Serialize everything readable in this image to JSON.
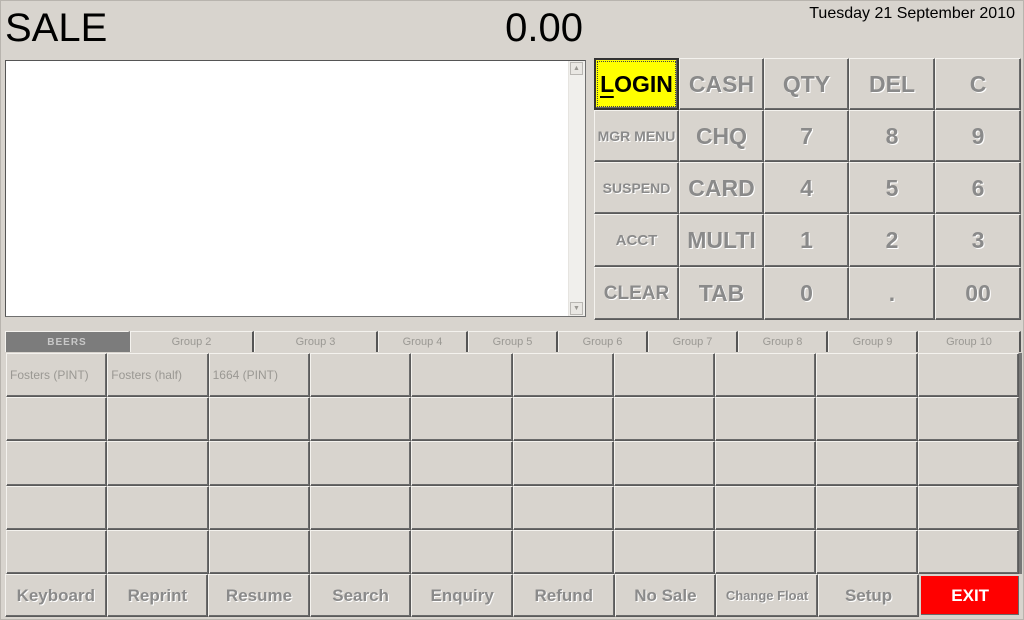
{
  "header": {
    "mode_title": "SALE",
    "total": "0.00",
    "date": "Tuesday 21 September 2010"
  },
  "receipt": {
    "lines": [],
    "scroll_up_icon": "triangle-up",
    "scroll_down_icon": "triangle-down"
  },
  "keypad": {
    "keys": [
      {
        "label": "LOGIN",
        "name": "login-button",
        "style": "login"
      },
      {
        "label": "CASH",
        "name": "cash-button",
        "style": ""
      },
      {
        "label": "QTY",
        "name": "qty-button",
        "style": ""
      },
      {
        "label": "DEL",
        "name": "del-button",
        "style": ""
      },
      {
        "label": "C",
        "name": "c-button",
        "style": ""
      },
      {
        "label": "MGR MENU",
        "name": "mgr-menu-button",
        "style": "small"
      },
      {
        "label": "CHQ",
        "name": "chq-button",
        "style": ""
      },
      {
        "label": "7",
        "name": "key-7",
        "style": ""
      },
      {
        "label": "8",
        "name": "key-8",
        "style": ""
      },
      {
        "label": "9",
        "name": "key-9",
        "style": ""
      },
      {
        "label": "SUSPEND",
        "name": "suspend-button",
        "style": "small"
      },
      {
        "label": "CARD",
        "name": "card-button",
        "style": ""
      },
      {
        "label": "4",
        "name": "key-4",
        "style": ""
      },
      {
        "label": "5",
        "name": "key-5",
        "style": ""
      },
      {
        "label": "6",
        "name": "key-6",
        "style": ""
      },
      {
        "label": "ACCT",
        "name": "acct-button",
        "style": "medium"
      },
      {
        "label": "MULTI",
        "name": "multi-button",
        "style": ""
      },
      {
        "label": "1",
        "name": "key-1",
        "style": ""
      },
      {
        "label": "2",
        "name": "key-2",
        "style": ""
      },
      {
        "label": "3",
        "name": "key-3",
        "style": ""
      },
      {
        "label": "CLEAR",
        "name": "clear-button",
        "style": "medium-lg"
      },
      {
        "label": "TAB",
        "name": "tab-button",
        "style": ""
      },
      {
        "label": "0",
        "name": "key-0",
        "style": ""
      },
      {
        "label": ".",
        "name": "key-decimal",
        "style": ""
      },
      {
        "label": "00",
        "name": "key-00",
        "style": ""
      }
    ]
  },
  "groups": {
    "active_index": 0,
    "tabs": [
      "BEERS",
      "Group 2",
      "Group 3",
      "Group 4",
      "Group 5",
      "Group 6",
      "Group 7",
      "Group 8",
      "Group 9",
      "Group 10"
    ]
  },
  "items": {
    "rows": 5,
    "cols": 10,
    "labels": [
      "Fosters (PINT)",
      "Fosters (half)",
      "1664 (PINT)"
    ]
  },
  "footer": {
    "buttons": [
      {
        "label": "Keyboard",
        "name": "keyboard-button",
        "style": ""
      },
      {
        "label": "Reprint",
        "name": "reprint-button",
        "style": ""
      },
      {
        "label": "Resume",
        "name": "resume-button",
        "style": ""
      },
      {
        "label": "Search",
        "name": "search-button",
        "style": ""
      },
      {
        "label": "Enquiry",
        "name": "enquiry-button",
        "style": ""
      },
      {
        "label": "Refund",
        "name": "refund-button",
        "style": ""
      },
      {
        "label": "No Sale",
        "name": "no-sale-button",
        "style": ""
      },
      {
        "label": "Change Float",
        "name": "change-float-button",
        "style": "narrow"
      },
      {
        "label": "Setup",
        "name": "setup-button",
        "style": ""
      },
      {
        "label": "EXIT",
        "name": "exit-button",
        "style": "exit"
      }
    ]
  },
  "colors": {
    "background": "#d8d4ce",
    "login_highlight": "#ffff00",
    "exit_red": "#ff0000",
    "active_tab": "#7c7c7c"
  }
}
